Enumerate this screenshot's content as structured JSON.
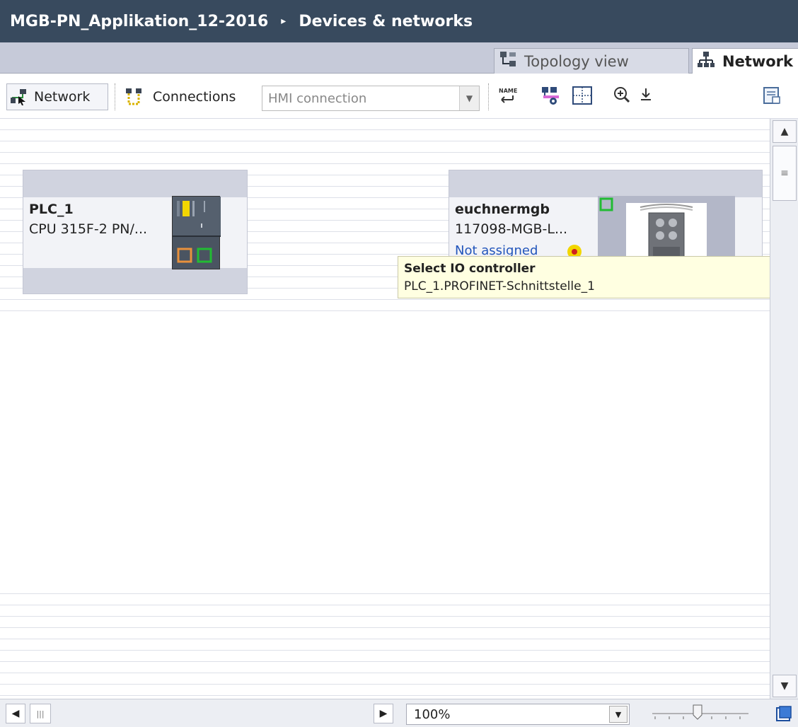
{
  "title": {
    "project": "MGB-PN_Applikation_12-2016",
    "separator": "▸",
    "section": "Devices & networks"
  },
  "view_tabs": {
    "topology": "Topology view",
    "network": "Network view"
  },
  "toolbar": {
    "network_label": "Network",
    "connections_label": "Connections",
    "connection_type": "HMI connection",
    "icons": [
      "name-icon",
      "show-address-icon",
      "grid-icon",
      "zoom-in-icon",
      "export-icon"
    ]
  },
  "devices": {
    "plc": {
      "name": "PLC_1",
      "type": "CPU 315F-2 PN/..."
    },
    "mgb": {
      "name": "euchnermgb",
      "type": "117098-MGB-L...",
      "io_status": "Not assigned"
    }
  },
  "tooltip": {
    "title": "Select IO controller",
    "value": "PLC_1.PROFINET-Schnittstelle_1"
  },
  "zoom": {
    "value": "100%",
    "level_fraction": 0.5
  },
  "colors": {
    "titlebar": "#384a5e",
    "port_orange": "#e8913c",
    "port_green": "#22bb33",
    "status_yellow": "#f2d600",
    "link_blue": "#2255bb",
    "tooltip_bg": "#ffffe1"
  }
}
